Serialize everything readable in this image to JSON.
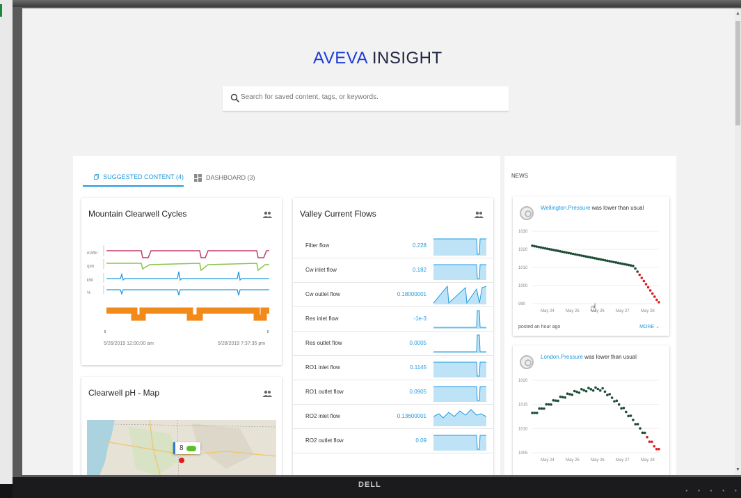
{
  "app": {
    "logo_brand": "AVEVA",
    "logo_product": "INSIGHT"
  },
  "search": {
    "placeholder": "Search for saved content, tags, or keywords."
  },
  "tabs": [
    {
      "label": "SUGGESTED CONTENT (4)",
      "icon": "copy-icon",
      "active": true
    },
    {
      "label": "DASHBOARD (3)",
      "icon": "dashboard-icon",
      "active": false
    }
  ],
  "cards": {
    "cycles": {
      "title": "Mountain Clearwell Cycles",
      "axis_labels": [
        "m3/hr",
        "rpm",
        "kW",
        "%"
      ],
      "start_time": "5/26/2019 12:00:00 am",
      "end_time": "5/28/2019 7:37:35 pm"
    },
    "map": {
      "title": "Clearwell pH - Map",
      "marker_value": "8"
    },
    "flows": {
      "title": "Valley Current Flows",
      "rows": [
        {
          "name": "Filter flow",
          "value": "0.228"
        },
        {
          "name": "Cw inlet flow",
          "value": "0.182"
        },
        {
          "name": "Cw outlet flow",
          "value": "0.18000001"
        },
        {
          "name": "Res inlet flow",
          "value": "-1e-3"
        },
        {
          "name": "Res outlet flow",
          "value": "0.0005"
        },
        {
          "name": "RO1 inlet flow",
          "value": "0.1145"
        },
        {
          "name": "RO1 outlet flow",
          "value": "0.0905"
        },
        {
          "name": "RO2 inlet flow",
          "value": "0.13600001"
        },
        {
          "name": "RO2 outlet flow",
          "value": "0.09"
        }
      ]
    }
  },
  "news": {
    "title": "NEWS",
    "items": [
      {
        "tag": "Wellington.Pressure",
        "text": " was lower than usual",
        "footer": "posted an hour ago",
        "more": "MORE",
        "y_ticks": [
          "1030",
          "1020",
          "1010",
          "1000",
          "990"
        ],
        "x_ticks": [
          "May 24",
          "May 25",
          "May 26",
          "May 27",
          "May 28"
        ]
      },
      {
        "tag": "London.Pressure",
        "text": " was lower than usual",
        "y_ticks": [
          "1020",
          "1015",
          "1010",
          "1005"
        ],
        "x_ticks": [
          "May 24",
          "May 25",
          "May 26",
          "May 27",
          "May 28"
        ]
      }
    ]
  },
  "colors": {
    "accent": "#1e9ae0",
    "brand": "#1c3bd6",
    "alert": "#e31b1b",
    "series_dark": "#1d4d36"
  },
  "monitor": {
    "brand": "DELL"
  }
}
